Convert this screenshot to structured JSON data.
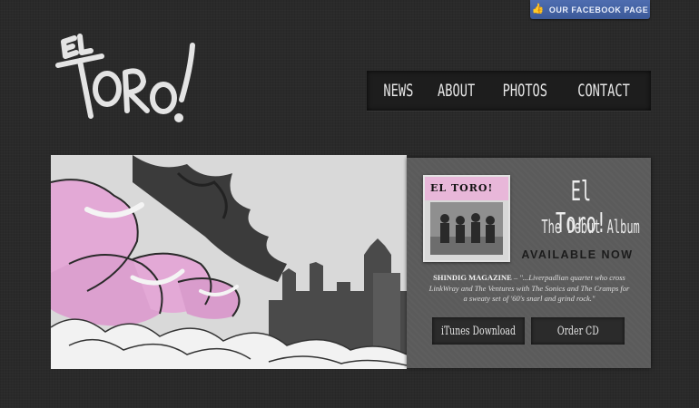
{
  "header": {
    "facebook_label": "OUR FACEBOOK PAGE",
    "logo_text": "EL TORO!"
  },
  "nav": {
    "items": [
      "NEWS",
      "ABOUT",
      "PHOTOS",
      "CONTACT"
    ]
  },
  "promo": {
    "cover_title": "EL TORO!",
    "band_name": "El Toro!",
    "album_title": "The Debut Album",
    "availability": "AVAILABLE NOW",
    "quote_source": "SHINDIG MAGAZINE",
    "quote_text": "– \"...Liverpadlian quartet who cross LinkWray and The Ventures with The Sonics and The Cramps for a sweaty set of '60's snarl and grind rock.\"",
    "itunes_label": "iTunes Download",
    "order_label": "Order CD"
  },
  "colors": {
    "background": "#2a2a2a",
    "facebook_blue": "#3b5998",
    "bull_pink": "#e3a9d6",
    "panel_gray": "#5b5b5b"
  },
  "icons": {
    "facebook": "thumbs-up-icon"
  }
}
